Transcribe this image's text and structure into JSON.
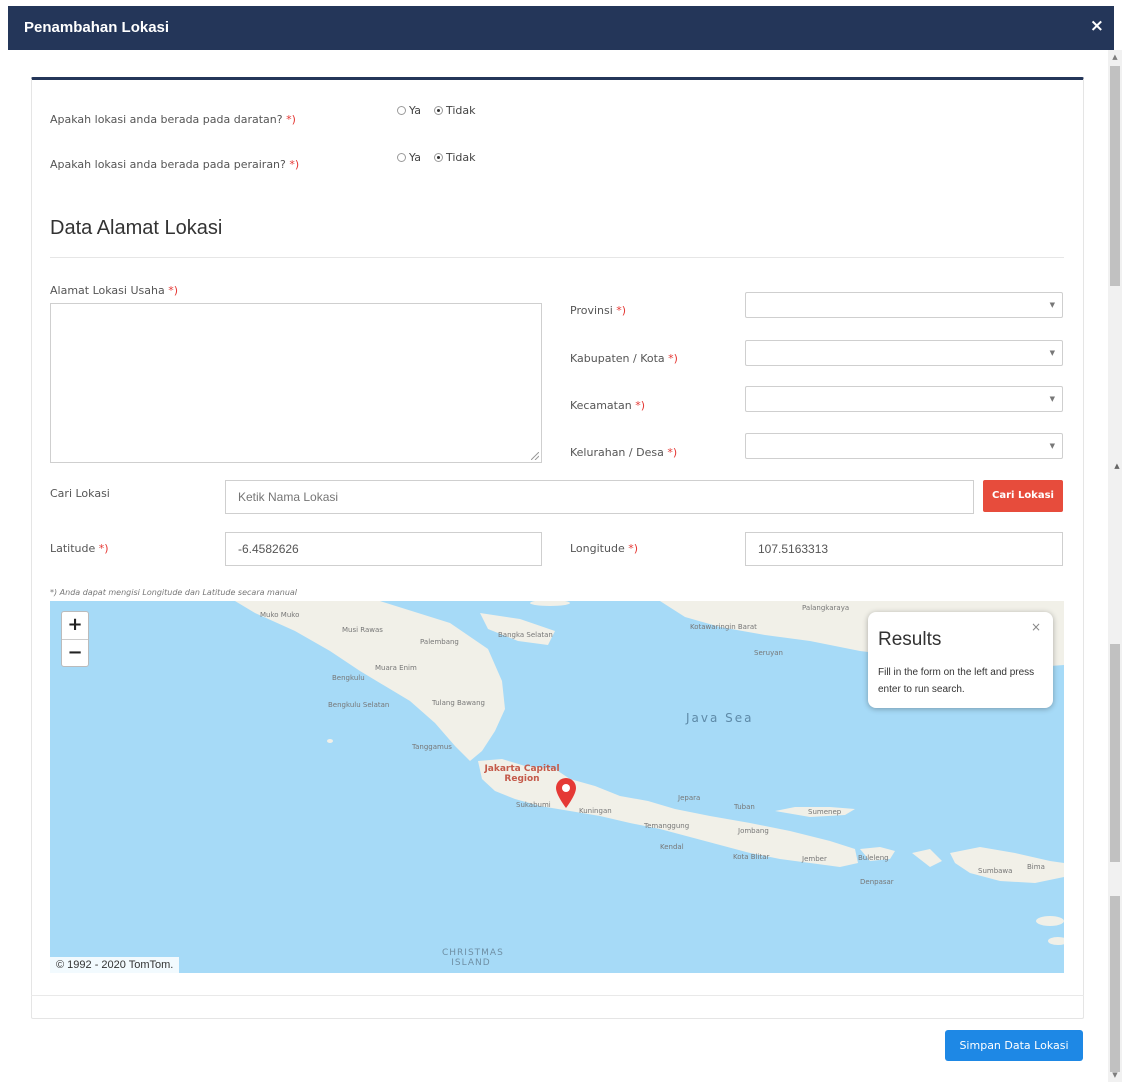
{
  "modal": {
    "title": "Penambahan Lokasi",
    "close_label": "×"
  },
  "questions": [
    {
      "label": "Apakah lokasi anda berada pada daratan?",
      "required": "*)",
      "options": [
        "Ya",
        "Tidak"
      ],
      "selected": "Tidak"
    },
    {
      "label": "Apakah lokasi anda berada pada perairan?",
      "required": "*)",
      "options": [
        "Ya",
        "Tidak"
      ],
      "selected": "Tidak"
    }
  ],
  "section": {
    "title": "Data Alamat Lokasi"
  },
  "address": {
    "label": "Alamat Lokasi Usaha",
    "required": "*)",
    "value": ""
  },
  "region_fields": [
    {
      "label": "Provinsi",
      "required": "*)",
      "value": ""
    },
    {
      "label": "Kabupaten / Kota",
      "required": "*)",
      "value": ""
    },
    {
      "label": "Kecamatan",
      "required": "*)",
      "value": ""
    },
    {
      "label": "Kelurahan / Desa",
      "required": "*)",
      "value": ""
    }
  ],
  "search": {
    "label": "Cari Lokasi",
    "placeholder": "Ketik Nama Lokasi",
    "button_label": "Cari Lokasi"
  },
  "coordinates": {
    "latitude_label": "Latitude",
    "latitude_required": "*)",
    "latitude_value": "-6.4582626",
    "longitude_label": "Longitude",
    "longitude_required": "*)",
    "longitude_value": "107.5163313"
  },
  "note": "*) Anda dapat mengisi Longitude dan Latitude secara manual",
  "map": {
    "zoom_in": "+",
    "zoom_out": "−",
    "attribution": "© 1992 - 2020 TomTom.",
    "labels": {
      "mukomuko": "Muko Muko",
      "musi_rawas": "Musi Rawas",
      "palembang": "Palembang",
      "bangka_selatan": "Bangka Selatan",
      "ketawaringin_barat": "Kotawaringin Barat",
      "palangkaraya": "Palangkaraya",
      "seruyan": "Seruyan",
      "bengkulu": "Bengkulu",
      "muara_enim": "Muara Enim",
      "bengkulu_selatan": "Bengkulu Selatan",
      "tulang_bawang": "Tulang Bawang",
      "tanggamus": "Tanggamus",
      "java_sea": "Java Sea",
      "jakarta": "Jakarta Capital Region",
      "sukabumi": "Sukabumi",
      "kuningan": "Kuningan",
      "jepara": "Jepara",
      "tuban": "Tuban",
      "sumenep": "Sumenep",
      "temanggung": "Temanggung",
      "jombang": "Jombang",
      "kota_blitar": "Kota Blitar",
      "jember": "Jember",
      "buleleng": "Buleleng",
      "denpasar": "Denpasar",
      "sumbawa": "Sumbawa",
      "bima": "Bima",
      "kendal": "Kendal",
      "christmas_island": "CHRISTMAS ISLAND"
    },
    "results": {
      "title": "Results",
      "text": "Fill in the form on the left and press enter to run search.",
      "close": "×"
    }
  },
  "save_button": "Simpan Data Lokasi"
}
